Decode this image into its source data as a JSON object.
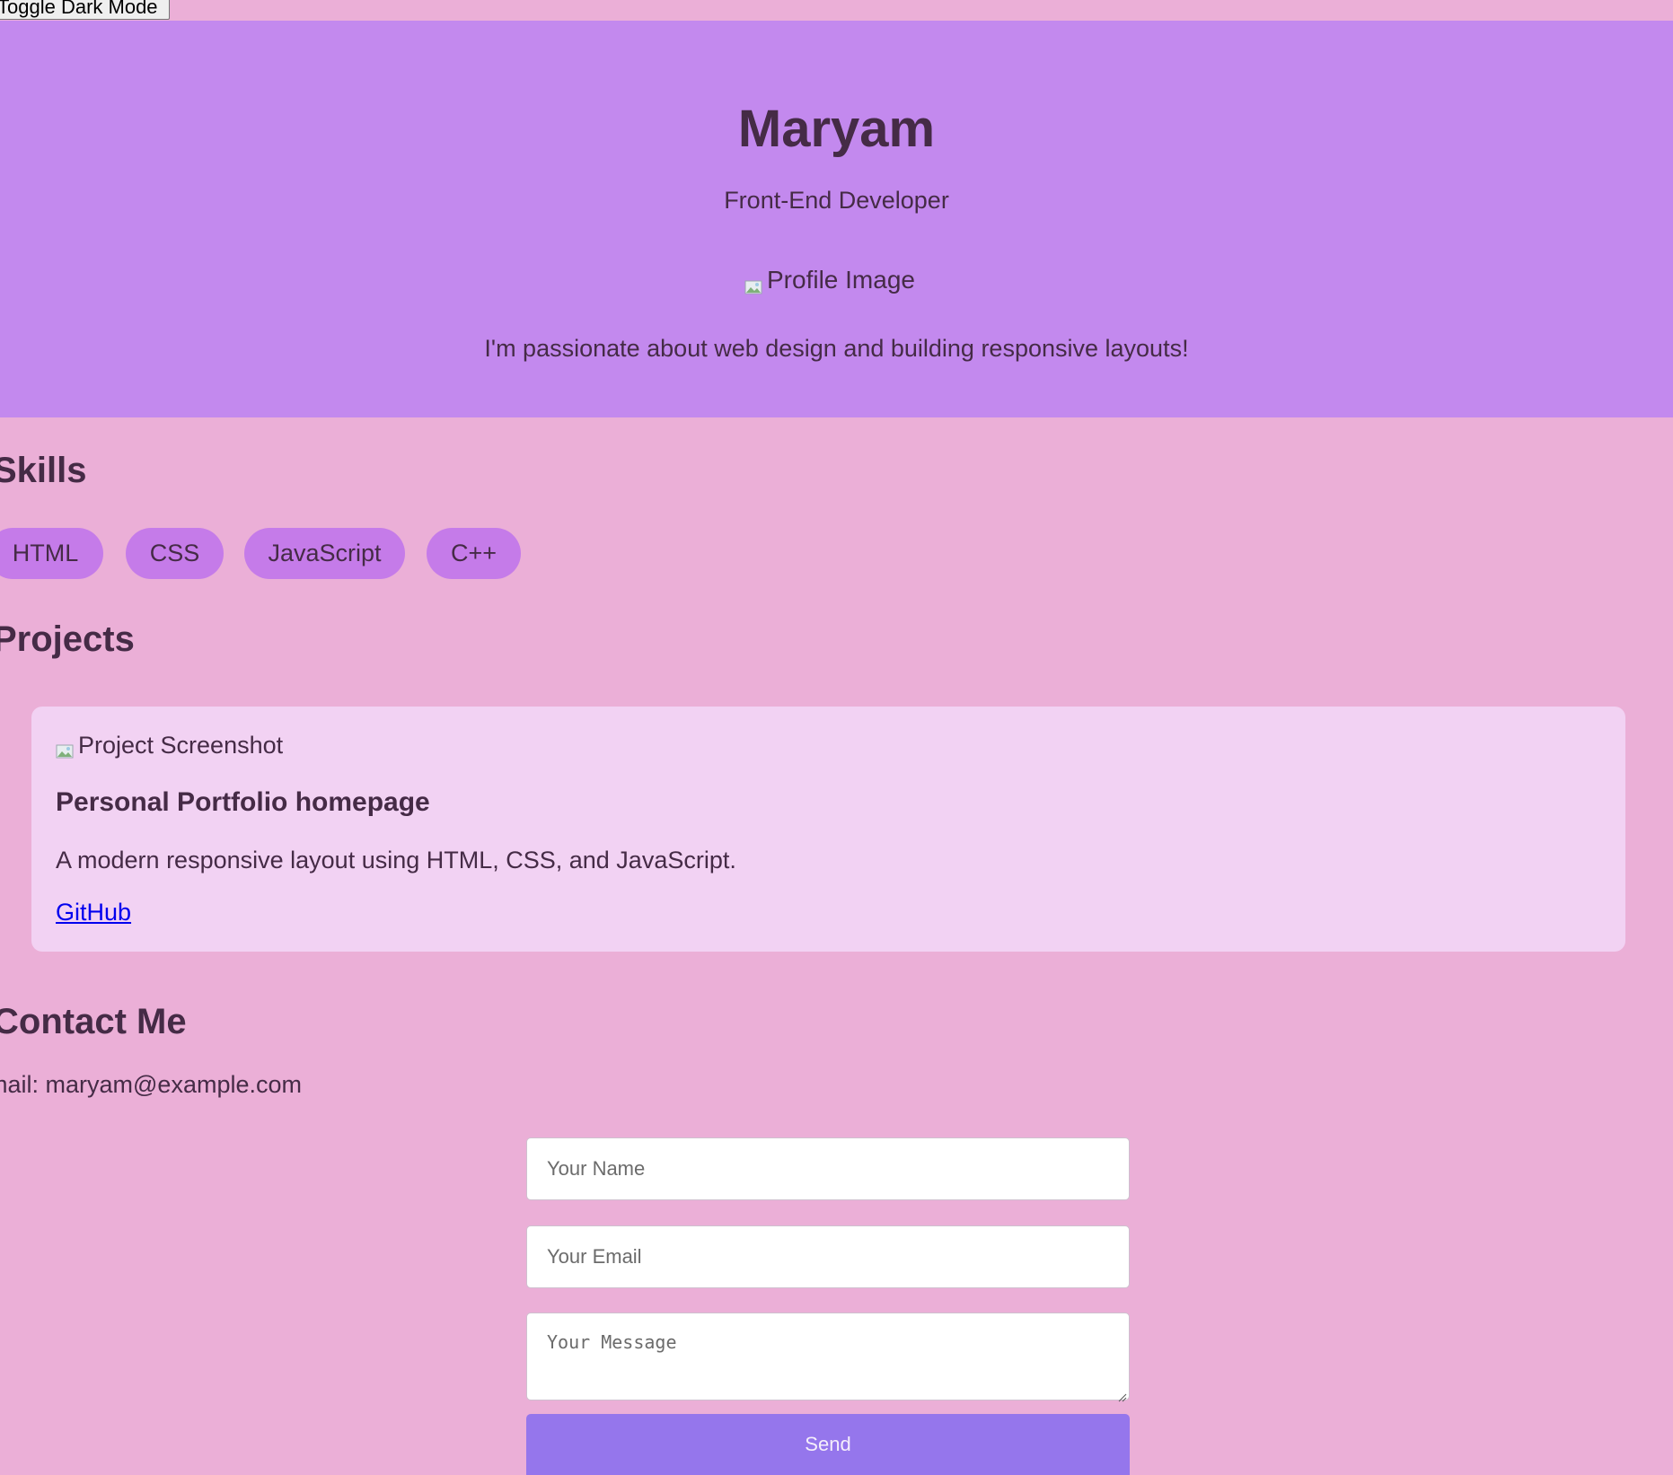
{
  "toggle": {
    "label": "Toggle Dark Mode"
  },
  "header": {
    "name": "Maryam",
    "role": "Front-End Developer",
    "profile_image_alt": "Profile Image",
    "about": "I'm passionate about web design and building responsive layouts!"
  },
  "skills": {
    "title": "Skills",
    "items": [
      "HTML",
      "CSS",
      "JavaScript",
      "C++"
    ]
  },
  "projects": {
    "title": "Projects",
    "items": [
      {
        "image_alt": "Project Screenshot",
        "title": "Personal Portfolio homepage",
        "description": "A modern responsive layout using HTML, CSS, and JavaScript.",
        "link_label": "GitHub"
      }
    ]
  },
  "contact": {
    "title": "Contact Me",
    "email_line": "mail: maryam@example.com",
    "form": {
      "name_placeholder": "Your Name",
      "email_placeholder": "Your Email",
      "message_placeholder": "Your Message",
      "send_label": "Send"
    }
  },
  "colors": {
    "page_background": "#ebafd7",
    "header_background": "#c389ee",
    "skill_tag": "#c57be9",
    "project_card": "#f2d2f3",
    "send_button": "#9576ec",
    "text": "#452b46",
    "link": "#0000ee"
  },
  "icons": {
    "broken_image": "broken-image-icon",
    "resize_grip": "resize-grip-icon"
  }
}
